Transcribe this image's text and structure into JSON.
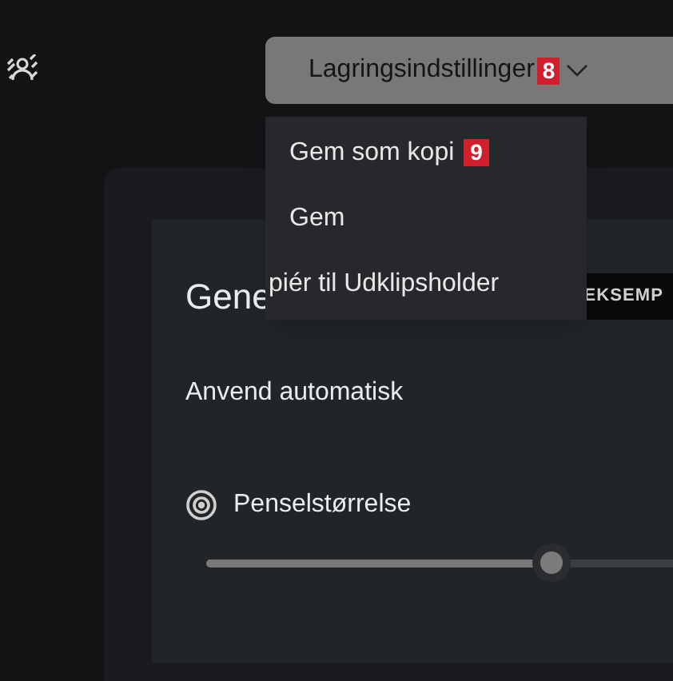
{
  "save_options_button": {
    "label": "Lagringsindstillinger",
    "badge": "8"
  },
  "menu": {
    "items": [
      {
        "label": "Gem som kopi",
        "badge": "9"
      },
      {
        "label": "Gem"
      },
      {
        "label": "piér til Udklipsholder"
      }
    ]
  },
  "card": {
    "title": "Gene",
    "tag": "EKSEMP",
    "auto_apply": "Anvend automatisk",
    "brush_size": {
      "label": "Penselstørrelse",
      "level": 0.74
    }
  }
}
